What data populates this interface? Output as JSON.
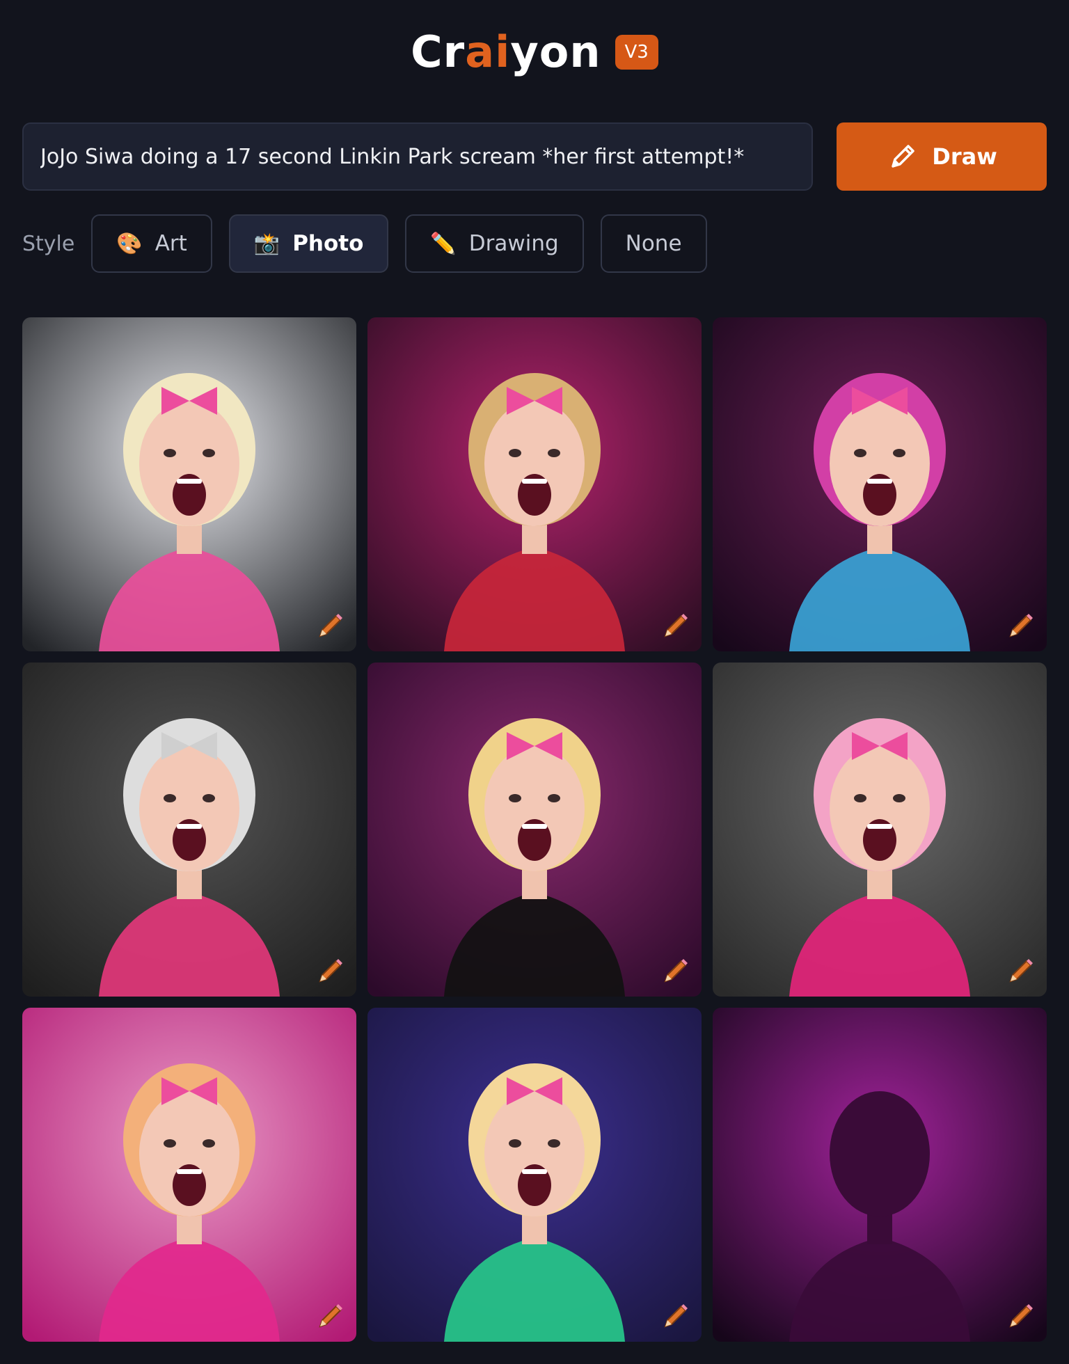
{
  "header": {
    "logo_prefix": "Cr",
    "logo_ai": "ai",
    "logo_suffix": "yon",
    "version": "V3"
  },
  "prompt": {
    "text": "JoJo Siwa doing a 17 second Linkin Park scream *her first attempt!*"
  },
  "draw_button": {
    "label": "Draw",
    "icon": "pencil-icon"
  },
  "style": {
    "label": "Style",
    "options": [
      {
        "label": "Art",
        "icon": "palette-icon",
        "emoji": "🎨",
        "active": false
      },
      {
        "label": "Photo",
        "icon": "camera-flash-icon",
        "emoji": "📸",
        "active": true
      },
      {
        "label": "Drawing",
        "icon": "pencil-icon",
        "emoji": "✏️",
        "active": false
      },
      {
        "label": "None",
        "icon": "",
        "emoji": "",
        "active": false
      }
    ]
  },
  "results": [
    {
      "bg": [
        "#e8e9ee",
        "#222428"
      ],
      "accent": "#e94e9a",
      "hair": "#f1e7c2",
      "mood": "grey-stage"
    },
    {
      "bg": [
        "#b5236d",
        "#2b0d22"
      ],
      "accent": "#c8263a",
      "hair": "#d9b073",
      "mood": "magenta-spot"
    },
    {
      "bg": [
        "#6a1f55",
        "#17071a"
      ],
      "accent": "#3aa3d6",
      "hair": "#d23fa6",
      "mood": "purple-stage"
    },
    {
      "bg": [
        "#555555",
        "#1e1e1e"
      ],
      "accent": "#e2377a",
      "hair": "#dddddd",
      "mood": "monochrome"
    },
    {
      "bg": [
        "#8a2a6e",
        "#2c0a2a"
      ],
      "accent": "#111111",
      "hair": "#f0d28a",
      "mood": "violet-backdrop"
    },
    {
      "bg": [
        "#6a6a6a",
        "#2a2a2a"
      ],
      "accent": "#e3247a",
      "hair": "#f3a3c6",
      "mood": "grey-backdrop"
    },
    {
      "bg": [
        "#e99ac7",
        "#b21a74"
      ],
      "accent": "#e2288c",
      "hair": "#f3b07a",
      "mood": "pink-blur"
    },
    {
      "bg": [
        "#3c2f8f",
        "#1a163f"
      ],
      "accent": "#27c88a",
      "hair": "#f4d79a",
      "mood": "blue-stage"
    },
    {
      "bg": [
        "#a1229a",
        "#16061a"
      ],
      "accent": "#e243d2",
      "hair": "#3a0b38",
      "mood": "silhouette"
    }
  ]
}
